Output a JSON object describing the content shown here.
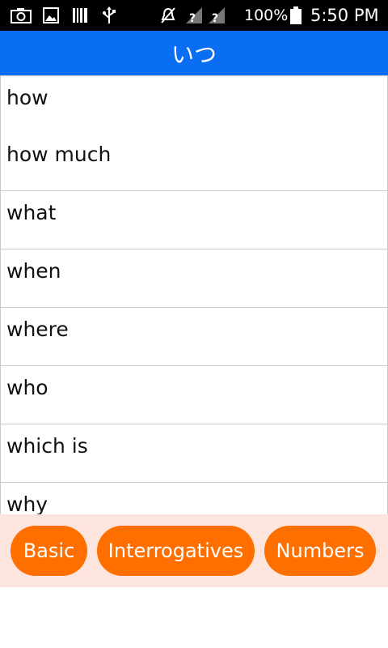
{
  "status_bar": {
    "battery_percent": "100%",
    "time": "5:50 PM",
    "icons": [
      "camera-icon",
      "image-icon",
      "barcode-icon",
      "usb-icon",
      "mute-icon",
      "signal-unknown-icon",
      "signal-unknown-icon",
      "battery-icon"
    ]
  },
  "header": {
    "title": "いつ"
  },
  "list": {
    "items": [
      {
        "label": "how"
      },
      {
        "label": "how much"
      },
      {
        "label": "what"
      },
      {
        "label": "when"
      },
      {
        "label": "where"
      },
      {
        "label": "who"
      },
      {
        "label": "which is"
      },
      {
        "label": "why"
      }
    ]
  },
  "bottom_bar": {
    "buttons": [
      {
        "label": "Basic"
      },
      {
        "label": "Interrogatives"
      },
      {
        "label": "Numbers"
      }
    ]
  },
  "colors": {
    "header_bg": "#0a6ef5",
    "button_bg": "#ff6f00",
    "bottom_bar_bg": "#fde4dc"
  }
}
